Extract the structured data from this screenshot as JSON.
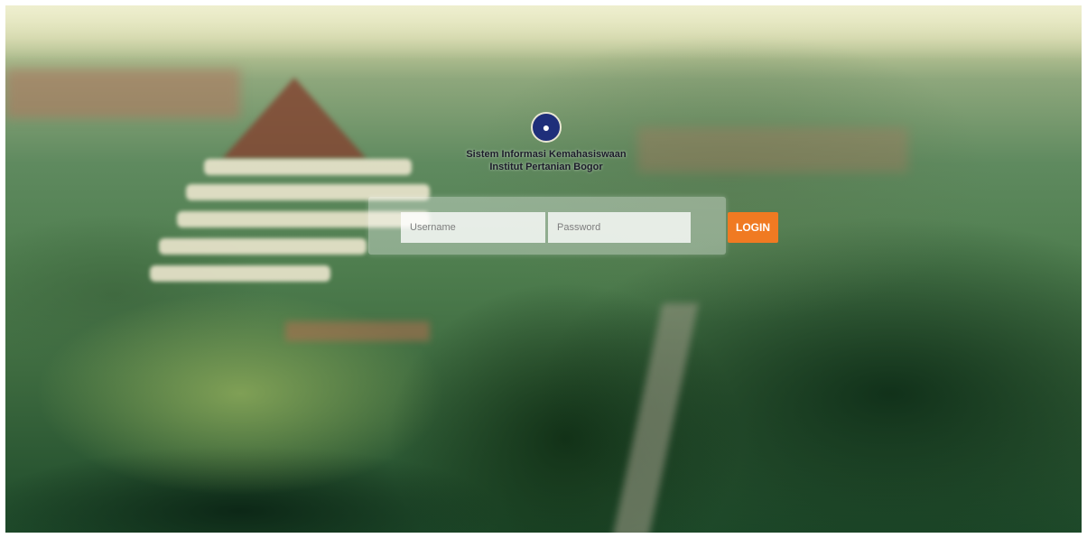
{
  "brand": {
    "logo_icon": "university-seal-icon",
    "line1": "Sistem Informasi Kemahasiswaan",
    "line2": "Institut Pertanian Bogor"
  },
  "login_form": {
    "username_placeholder": "Username",
    "username_value": "",
    "password_placeholder": "Password",
    "password_value": "",
    "login_label": "LOGIN"
  },
  "colors": {
    "accent": "#f07a22",
    "logo_blue": "#1f2f7a"
  }
}
